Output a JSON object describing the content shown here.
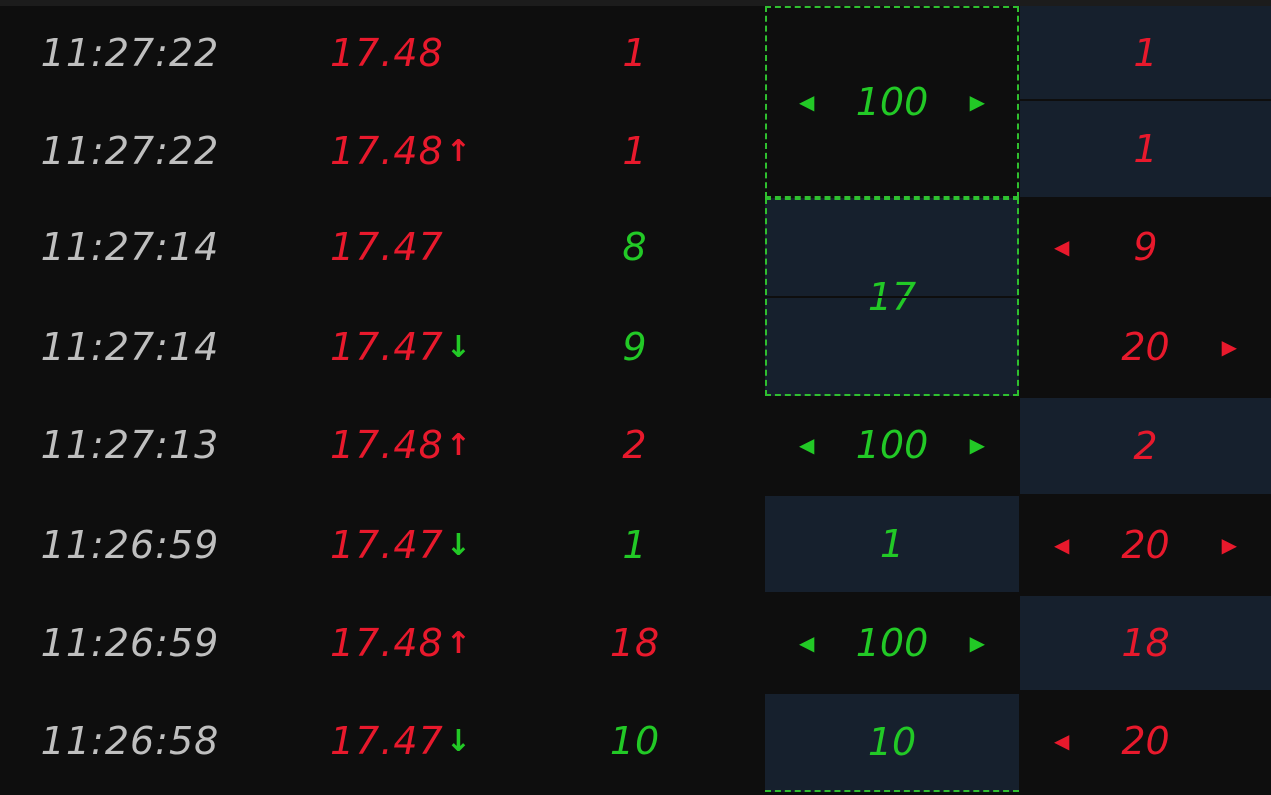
{
  "colors": {
    "background": "#0e0e0e",
    "panel": "#16202d",
    "up": "#e8192c",
    "down": "#22c926",
    "time": "#bfbfbf"
  },
  "trades": [
    {
      "time": "11:27:22",
      "price": "17.48",
      "arrow": "",
      "arrow_icon": "",
      "vol": "1",
      "vol_color": "red"
    },
    {
      "time": "11:27:22",
      "price": "17.48",
      "arrow": "↑",
      "arrow_icon": "up-arrow-icon",
      "vol": "1",
      "vol_color": "red"
    },
    {
      "time": "11:27:14",
      "price": "17.47",
      "arrow": "",
      "arrow_icon": "",
      "vol": "8",
      "vol_color": "green"
    },
    {
      "time": "11:27:14",
      "price": "17.47",
      "arrow": "↓",
      "arrow_icon": "down-arrow-icon",
      "vol": "9",
      "vol_color": "green"
    },
    {
      "time": "11:27:13",
      "price": "17.48",
      "arrow": "↑",
      "arrow_icon": "up-arrow-icon",
      "vol": "2",
      "vol_color": "red"
    },
    {
      "time": "11:26:59",
      "price": "17.47",
      "arrow": "↓",
      "arrow_icon": "down-arrow-icon",
      "vol": "1",
      "vol_color": "green"
    },
    {
      "time": "11:26:59",
      "price": "17.48",
      "arrow": "↑",
      "arrow_icon": "up-arrow-icon",
      "vol": "18",
      "vol_color": "red"
    },
    {
      "time": "11:26:58",
      "price": "17.47",
      "arrow": "↓",
      "arrow_icon": "down-arrow-icon",
      "vol": "10",
      "vol_color": "green"
    }
  ],
  "buy_column": {
    "block1": "100",
    "block2": "17",
    "row5": "100",
    "row6": "1",
    "row7": "100",
    "row8": "10"
  },
  "sell_column": {
    "row1": "1",
    "row2": "1",
    "row3": "9",
    "row4": "20",
    "row5": "2",
    "row6": "20",
    "row7": "18",
    "row8": "20"
  },
  "glyphs": {
    "left": "◀",
    "right": "▶"
  }
}
